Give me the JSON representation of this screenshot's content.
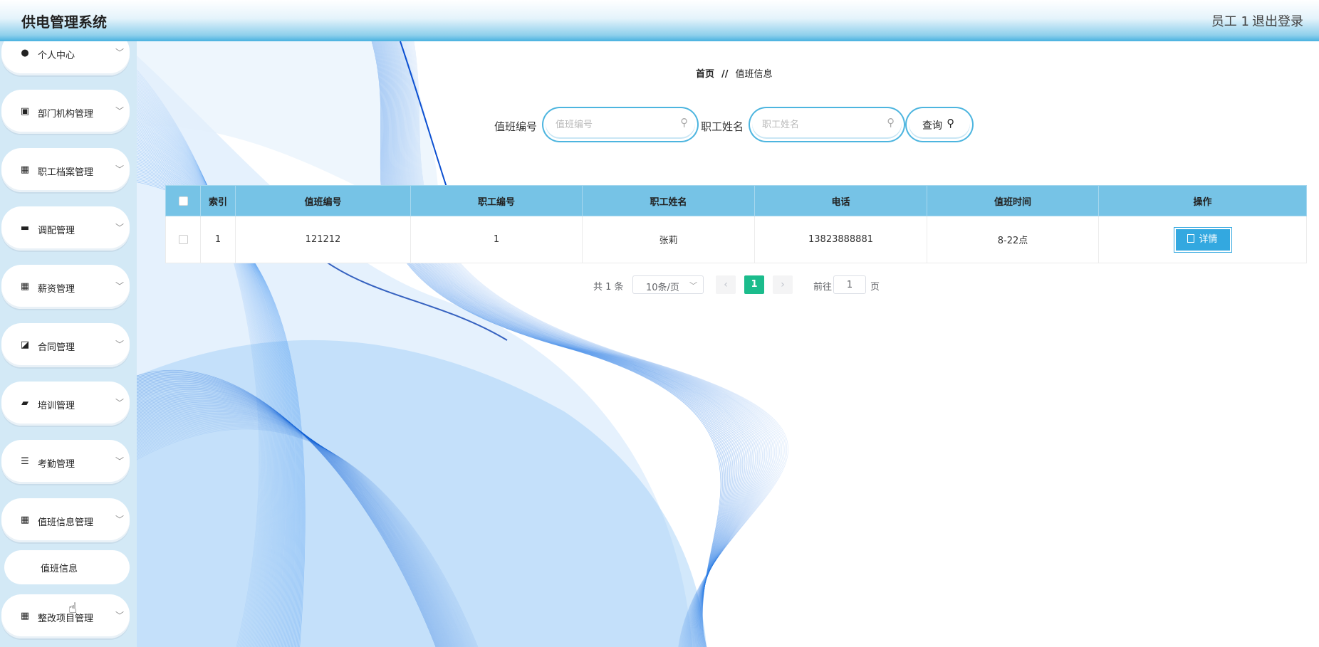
{
  "header": {
    "title": "供电管理系统",
    "user": "员工 1",
    "logout": "退出登录"
  },
  "sidebar": {
    "items": [
      {
        "label": "个人中心",
        "icon": "person-icon",
        "glyph": "●"
      },
      {
        "label": "部门机构管理",
        "icon": "clipboard-icon",
        "glyph": "▣"
      },
      {
        "label": "职工档案管理",
        "icon": "grid-icon",
        "glyph": "▦"
      },
      {
        "label": "调配管理",
        "icon": "chat-icon",
        "glyph": "▬"
      },
      {
        "label": "薪资管理",
        "icon": "grid-icon",
        "glyph": "▦"
      },
      {
        "label": "合同管理",
        "icon": "chart-icon",
        "glyph": "◪"
      },
      {
        "label": "培训管理",
        "icon": "briefcase-icon",
        "glyph": "▰"
      },
      {
        "label": "考勤管理",
        "icon": "list-icon",
        "glyph": "☰"
      },
      {
        "label": "值班信息管理",
        "icon": "grid-icon",
        "glyph": "▦"
      },
      {
        "label": "整改项目管理",
        "icon": "grid-icon",
        "glyph": "▦"
      }
    ],
    "sub_item": "值班信息"
  },
  "breadcrumb": {
    "home": "首页",
    "separator": "//",
    "current": "值班信息"
  },
  "search": {
    "duty_no_label": "值班编号",
    "duty_no_placeholder": "值班编号",
    "duty_no_value": "",
    "staff_name_label": "职工姓名",
    "staff_name_placeholder": "职工姓名",
    "staff_name_value": "",
    "query_button": "查询"
  },
  "table": {
    "columns": [
      "索引",
      "值班编号",
      "职工编号",
      "职工姓名",
      "电话",
      "值班时间",
      "操作"
    ],
    "rows": [
      {
        "index": "1",
        "duty_no": "121212",
        "staff_no": "1",
        "staff_name": "张莉",
        "phone": "13823888881",
        "duty_time": "8-22点",
        "action": "详情"
      }
    ]
  },
  "pagination": {
    "total": "共 1 条",
    "page_size": "10条/页",
    "current_page": "1",
    "goto_label": "前往",
    "goto_value": "1",
    "page_suffix": "页"
  },
  "colors": {
    "header_gradient_end": "#48b1e0",
    "sidebar_bg": "#d3e9f6",
    "table_header_bg": "#76c3e6",
    "detail_button": "#33a8e0",
    "pager_active": "#1bbc8c"
  }
}
